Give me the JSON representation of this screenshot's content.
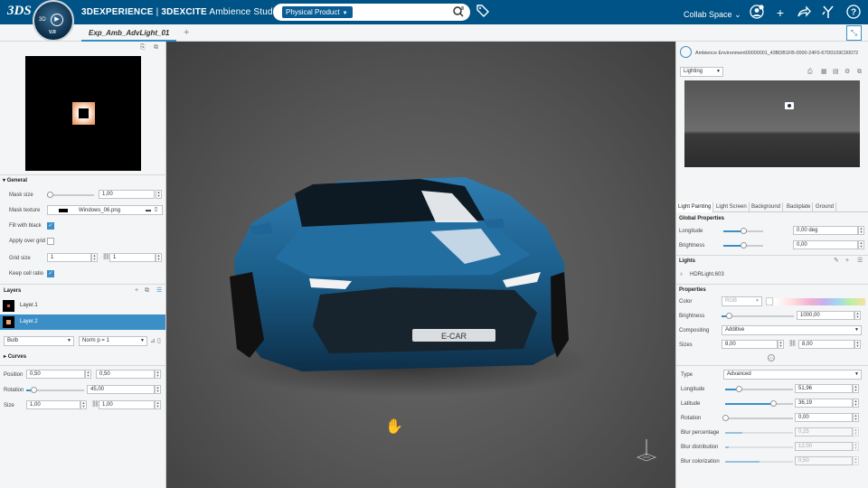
{
  "topbar": {
    "brand": "3DS",
    "compass_3d": "3D",
    "compass_version": "V.R",
    "app_brand": "3DEXPERIENCE",
    "app_separator": " | ",
    "app_name_bold": "3DEXCITE",
    "app_name": " Ambience Studio",
    "search_scope": "Physical Product",
    "search_placeholder": "",
    "collab_space": "Collab Space",
    "notification_count": "0",
    "icons": [
      "tag-icon",
      "user-icon",
      "plus-icon",
      "share-icon",
      "tools-icon",
      "help-icon"
    ]
  },
  "tabs": {
    "document_tab": "Exp_Amb_AdvLight_01",
    "add_tab": "+"
  },
  "left_panel": {
    "general_title": "General",
    "mask_size_label": "Mask size",
    "mask_size_value": "1,00",
    "mask_size_level": 0.05,
    "mask_texture_label": "Mask texture",
    "mask_texture_value": "Windows_06.png",
    "fill_with_black_label": "Fill with black",
    "fill_with_black": true,
    "apply_over_grid_label": "Apply over grid",
    "apply_over_grid": false,
    "grid_size_label": "Grid size",
    "grid_size_x": "1",
    "grid_size_y": "1",
    "keep_cell_ratio_label": "Keep cell ratio",
    "keep_cell_ratio": true,
    "layers_title": "Layers",
    "layers": [
      {
        "name": "Layer.1",
        "selected": false
      },
      {
        "name": "Layer.2",
        "selected": true
      }
    ],
    "shape_select": "Bulb",
    "norm_select": "Norm p = 1",
    "curves_title": "Curves",
    "position_label": "Position",
    "position_x": "0,50",
    "position_y": "0,50",
    "rotation_label": "Rotation",
    "rotation_value": "45,00",
    "rotation_level": 0.125,
    "size_label": "Size",
    "size_x": "1,00",
    "size_y": "1,00"
  },
  "viewport": {
    "plate_text": "E-CAR",
    "cursor": "hand-cursor-icon"
  },
  "right_panel": {
    "env_name": "Ambience Environment00000001_43BDB1FB-0000-24F0-67D0109C00072",
    "mode_select": "Lighting",
    "tabs": [
      "Light Painting",
      "Light Screen",
      "Background",
      "Backplate",
      "Ground"
    ],
    "active_tab": "Light Painting",
    "global_properties_title": "Global Properties",
    "global_longitude_label": "Longitude",
    "global_longitude_value": "0,00 deg",
    "global_longitude_level": 0.5,
    "global_brightness_label": "Brightness",
    "global_brightness_value": "0,00",
    "global_brightness_level": 0.5,
    "lights_title": "Lights",
    "light_name": "HDRLight.603",
    "properties_title": "Properties",
    "color_label": "Color",
    "color_mode": "RGB",
    "brightness_label": "Brightness",
    "brightness_value": "1000,00",
    "brightness_level": 0.1,
    "compositing_label": "Compositing",
    "compositing_value": "Additive",
    "sizes_label": "Sizes",
    "sizes_x": "8,00",
    "sizes_y": "8,00",
    "type_label": "Type",
    "type_value": "Advanced",
    "longitude_label": "Longitude",
    "longitude_value": "51,96",
    "longitude_level": 0.2,
    "latitude_label": "Latitude",
    "latitude_value": "36,19",
    "latitude_level": 0.7,
    "rotation_label": "Rotation",
    "rotation_value": "0,00",
    "rotation_level": 0.0,
    "blur_percentage_label": "Blur percentage",
    "blur_percentage_value": "0,25",
    "blur_percentage_level": 0.25,
    "blur_distribution_label": "Blur distribution",
    "blur_distribution_value": "12,00",
    "blur_distribution_level": 0.05,
    "blur_colorization_label": "Blur colorization",
    "blur_colorization_value": "0,50",
    "blur_colorization_level": 0.5
  },
  "colors": {
    "topbar": "#005386",
    "accent": "#3b8fc6",
    "car_body": "#1b5e8a"
  }
}
